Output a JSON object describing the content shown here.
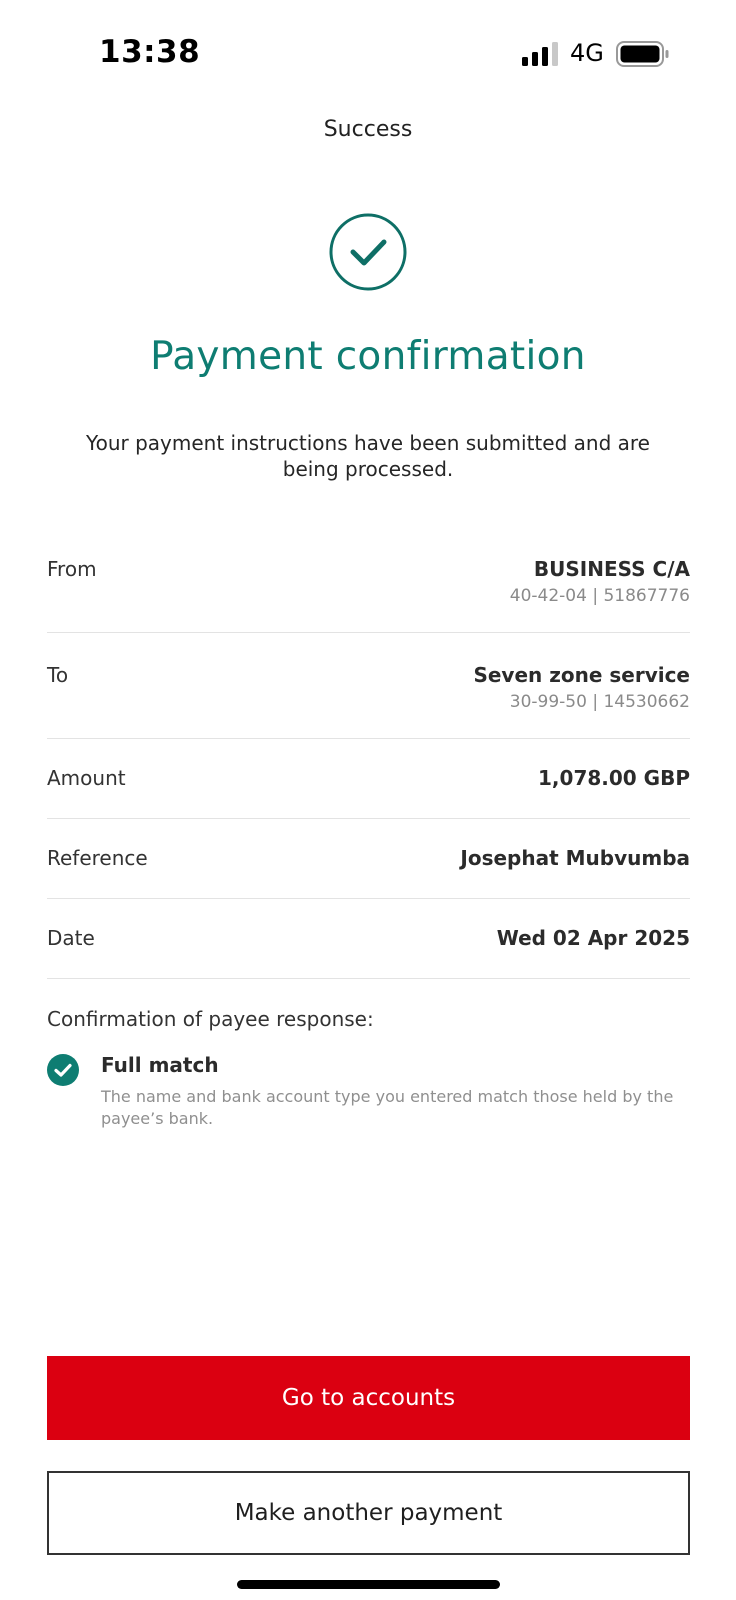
{
  "status_bar": {
    "time": "13:38",
    "network": "4G"
  },
  "nav": {
    "title": "Success"
  },
  "confirmation": {
    "headline": "Payment confirmation",
    "message": "Your payment instructions have been submitted and are being processed."
  },
  "details": {
    "from": {
      "label": "From",
      "value": "BUSINESS C/A",
      "sub": "40-42-04 | 51867776"
    },
    "to": {
      "label": "To",
      "value": "Seven zone service",
      "sub": "30-99-50 | 14530662"
    },
    "amount": {
      "label": "Amount",
      "value": "1,078.00 GBP"
    },
    "reference": {
      "label": "Reference",
      "value": "Josephat Mubvumba"
    },
    "date": {
      "label": "Date",
      "value": "Wed 02 Apr 2025"
    }
  },
  "payee_check": {
    "label": "Confirmation of payee response:",
    "result": "Full match",
    "description": "The name and bank account type you entered match those held by the payee’s bank."
  },
  "actions": {
    "primary": "Go to accounts",
    "secondary": "Make another payment"
  },
  "colors": {
    "accent": "#0e7d72",
    "brand_red": "#db0011"
  },
  "icons": [
    "signal-icon",
    "battery-icon",
    "success-check-icon",
    "match-check-icon"
  ]
}
